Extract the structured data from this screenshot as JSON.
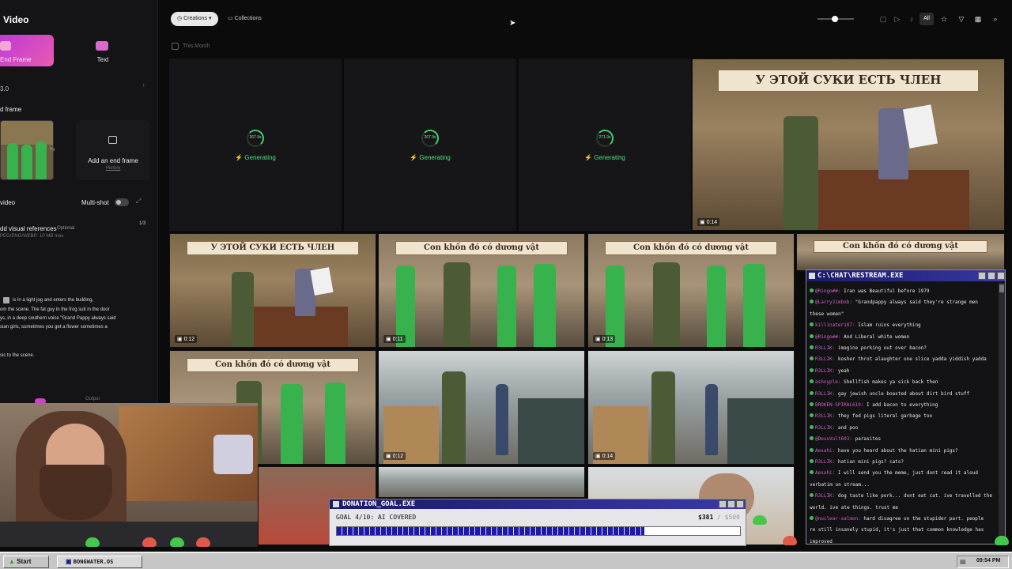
{
  "left_panel": {
    "title": "Video",
    "tabs": [
      {
        "label": "End Frame"
      },
      {
        "label": "Text"
      }
    ],
    "model_version": "3.0",
    "end_frame_heading": "d frame",
    "add_end_frame": "Add an end frame",
    "history": "History",
    "video_heading": "video",
    "multishot_label": "Multi-shot",
    "visual_refs_label": "dd visual references",
    "optional": "Optional",
    "refs_count": "1/3",
    "refs_formats": "PEG/PNG/WEBP: 10 MB max",
    "prompt_lines": [
      "is in a light jog and enters the building,",
      "om the scene. The fat guy in the frog suit in the door",
      "ys, in a deep southern voice \"Grand Pappy always said",
      "sian girls, sometimes you get a flower sometimes a",
      "sic to the scene."
    ],
    "output_label": "Output"
  },
  "topbar": {
    "creations": "Creations",
    "collections": "Collections",
    "filter_all": "All",
    "icons": [
      "image-filter-icon",
      "video-filter-icon",
      "audio-filter-icon",
      "star-icon",
      "filter-icon",
      "grid-icon",
      "search-icon"
    ]
  },
  "section_label": "This Month",
  "generating": [
    {
      "time": "267.9s",
      "label": "Generating"
    },
    {
      "time": "267.9s",
      "label": "Generating"
    },
    {
      "time": "271.9s",
      "label": "Generating"
    }
  ],
  "videos": [
    {
      "sign": "У ЭТОЙ СУКИ ЕСТЬ ЧЛЕН",
      "duration": "0:14",
      "scene": "ru"
    },
    {
      "sign": "У ЭТОЙ СУКИ ЕСТЬ ЧЛЕН",
      "duration": "0:12",
      "scene": "ru"
    },
    {
      "sign": "Con khốn đó có dương vật",
      "duration": "0:11",
      "scene": "vn"
    },
    {
      "sign": "Con khốn đó có dương vật",
      "duration": "0:13",
      "scene": "vn"
    },
    {
      "sign": "Con khốn đó có dương vật",
      "duration": "",
      "scene": "vn"
    },
    {
      "sign": "Con khốn đó có dương vật",
      "duration": "",
      "scene": "vn"
    },
    {
      "sign": "",
      "duration": "0:12",
      "scene": "alley"
    },
    {
      "sign": "",
      "duration": "0:14",
      "scene": "alley"
    }
  ],
  "chat": {
    "title": "C:\\CHAT\\RESTREAM.EXE",
    "messages": [
      {
        "user": "@Ringo##:",
        "text": "Iran was Beautiful before 1979"
      },
      {
        "user": "@LarryJimbob:",
        "text": "\"Grandpappy always said they're strange men"
      },
      {
        "user": "",
        "text": "these women\""
      },
      {
        "user": "killinater187:",
        "text": "Islam ruins everything"
      },
      {
        "user": "@Ringo##:",
        "text": "And Liberal white women"
      },
      {
        "user": "R3LLIK:",
        "text": "imagine porking out over bacon?"
      },
      {
        "user": "R3LLIK:",
        "text": "kosher throt alaughter one slice yadda yiddish yadda"
      },
      {
        "user": "R3LLIK:",
        "text": "yeah"
      },
      {
        "user": "ashnyple:",
        "text": "Shellfish makes ya sick back then"
      },
      {
        "user": "R3LLIK:",
        "text": "gay jewish uncle boasted about dirt bird stuff"
      },
      {
        "user": "BROKEN-SPIRAL619:",
        "text": "I add bacon to everything"
      },
      {
        "user": "R3LLIK:",
        "text": "they fed pigs literal garbage too"
      },
      {
        "user": "R3LLIK:",
        "text": "and poo"
      },
      {
        "user": "@DeusVult603:",
        "text": "parasites"
      },
      {
        "user": "Aesahi:",
        "text": "have you heard about the hatian mini pigs?"
      },
      {
        "user": "R3LLIK:",
        "text": "hatian mini pigs? cats?"
      },
      {
        "user": "Aesahi:",
        "text": "I will send you the meme, just dont read it aloud"
      },
      {
        "user": "",
        "text": "verbatim on stream..."
      },
      {
        "user": "R3LLIK:",
        "text": "dog taste like pork... dont eat cat. ive travelled the"
      },
      {
        "user": "",
        "text": "world. ive ate things. trust me"
      },
      {
        "user": "@nuclear-salmon:",
        "text": "hard disagree on the stupider part. people"
      },
      {
        "user": "",
        "text": "re still insanely stupid, it's just that common knowledge has"
      },
      {
        "user": "",
        "text": "improved"
      }
    ]
  },
  "donation": {
    "title": "DONATION_GOAL.EXE",
    "goal_text": "GOAL 4/10: AI COVERED",
    "raised": "$381",
    "target": "/ $500",
    "progress": 0.762
  },
  "taskbar": {
    "start": "Start",
    "app": "BONGWATER.OS",
    "clock": "09:54 PM"
  }
}
